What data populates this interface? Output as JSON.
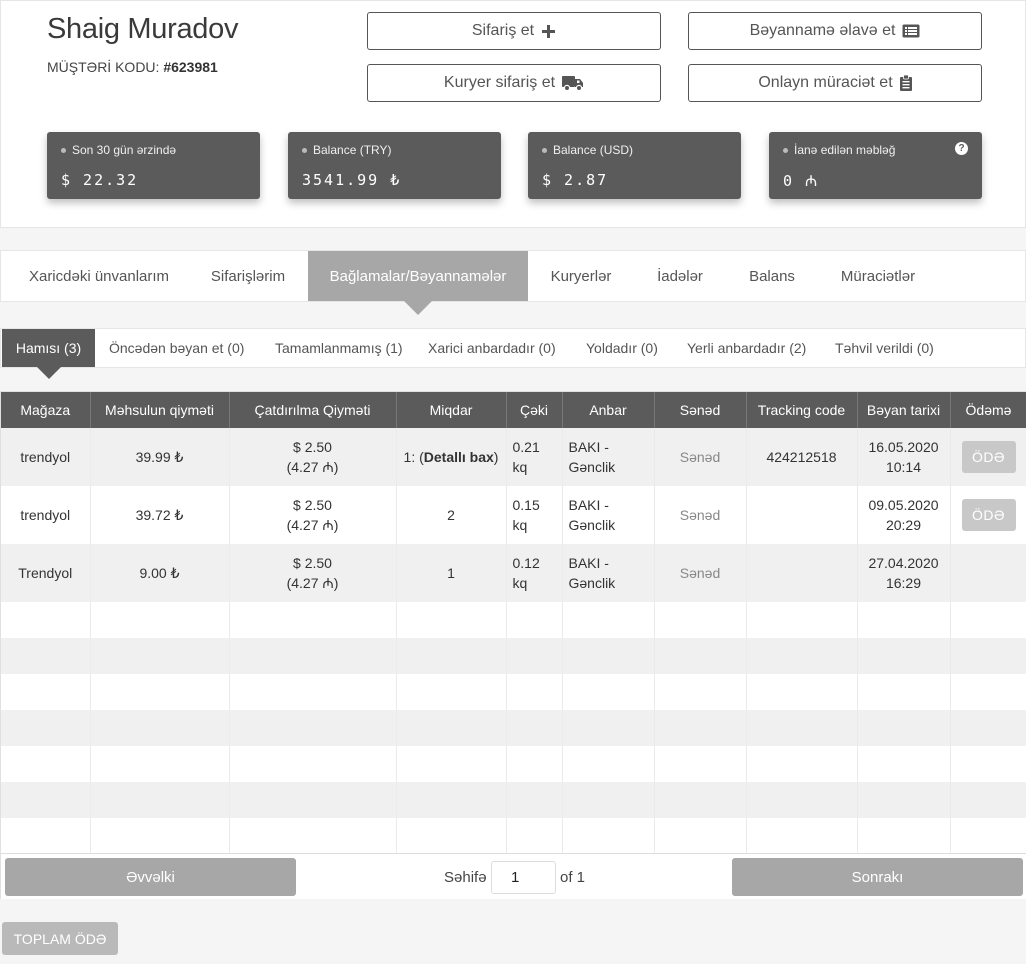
{
  "customer": {
    "name": "Shaig Muradov",
    "code_label": "MÜŞTƏRİ KODU:",
    "code_value": "#623981"
  },
  "actions": {
    "order": "Sifariş et",
    "declaration": "Bəyannamə əlavə et",
    "courier": "Kuryer sifariş et",
    "online": "Onlayn müraciət et"
  },
  "stats": [
    {
      "label": "Son 30 gün ərzində",
      "value": "$ 22.32"
    },
    {
      "label": "Balance (TRY)",
      "value": "3541.99 ₺"
    },
    {
      "label": "Balance (USD)",
      "value": "$ 2.87"
    },
    {
      "label": "İanə edilən məbləğ",
      "value": "0 ₼"
    }
  ],
  "main_tabs": [
    "Xaricdəki ünvanlarım",
    "Sifarişlərim",
    "Bağlamalar/Bəyannamələr",
    "Kuryerlər",
    "İadələr",
    "Balans",
    "Müraciətlər"
  ],
  "sub_tabs": [
    "Hamısı (3)",
    "Öncədən bəyan et (0)",
    "Tamamlanmamış (1)",
    "Xarici anbardadır (0)",
    "Yoldadır (0)",
    "Yerli anbardadır (2)",
    "Təhvil verildi (0)"
  ],
  "table": {
    "headers": [
      "Mağaza",
      "Məhsulun qiyməti",
      "Çatdırılma Qiyməti",
      "Miqdar",
      "Çəki",
      "Anbar",
      "Sənəd",
      "Tracking code",
      "Bəyan tarixi",
      "Ödəmə"
    ],
    "rows": [
      {
        "store": "trendyol",
        "price": "39.99 ₺",
        "ship_usd": "$ 2.50",
        "ship_azn": "(4.27 ₼)",
        "qty_prefix": "1: (",
        "qty_link": "Detallı bax",
        "qty_suffix": ")",
        "weight_a": "0.21",
        "weight_b": "kq",
        "wh_a": "BAKI -",
        "wh_b": "Gənclik",
        "doc": "Sənəd",
        "tracking": "424212518",
        "date": "16.05.2020",
        "time": "10:14",
        "pay": "ÖDƏ"
      },
      {
        "store": "trendyol",
        "price": "39.72 ₺",
        "ship_usd": "$ 2.50",
        "ship_azn": "(4.27 ₼)",
        "qty": "2",
        "weight_a": "0.15",
        "weight_b": "kq",
        "wh_a": "BAKI -",
        "wh_b": "Gənclik",
        "doc": "Sənəd",
        "tracking": "",
        "date": "09.05.2020",
        "time": "20:29",
        "pay": "ÖDƏ"
      },
      {
        "store": "Trendyol",
        "price": "9.00 ₺",
        "ship_usd": "$ 2.50",
        "ship_azn": "(4.27 ₼)",
        "qty": "1",
        "weight_a": "0.12",
        "weight_b": "kq",
        "wh_a": "BAKI -",
        "wh_b": "Gənclik",
        "doc": "Sənəd",
        "tracking": "",
        "date": "27.04.2020",
        "time": "16:29",
        "pay": ""
      }
    ]
  },
  "pager": {
    "prev": "Əvvəlki",
    "page_label": "Səhifə",
    "page_value": "1",
    "of_label": "of 1",
    "next": "Sonrakı"
  },
  "total_pay": "TOPLAM ÖDƏ"
}
